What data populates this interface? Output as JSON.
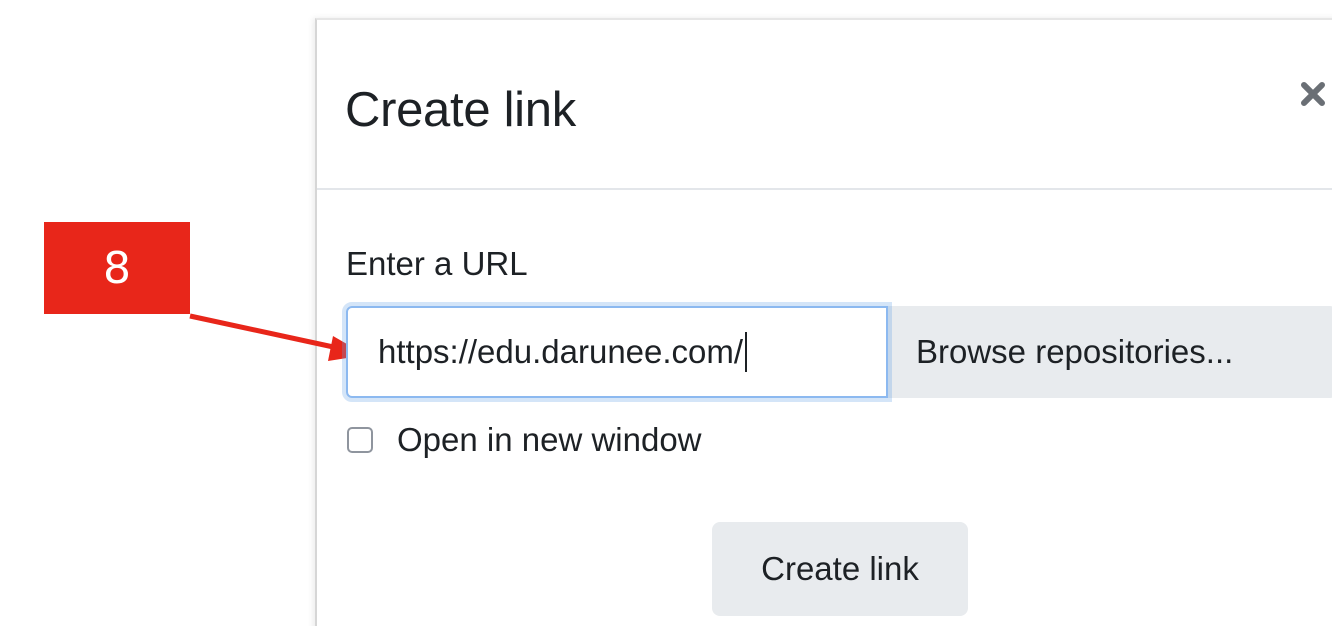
{
  "modal": {
    "title": "Create link",
    "close_icon": "close-icon"
  },
  "form": {
    "url_label": "Enter a URL",
    "url_value": "https://edu.darunee.com/",
    "browse_label": "Browse repositories...",
    "new_window_label": "Open in new window",
    "new_window_checked": false,
    "submit_label": "Create link"
  },
  "annotation": {
    "step_number": "8",
    "color": "#e8261a"
  },
  "colors": {
    "focus_border": "#8cb9f0",
    "button_bg": "#e8ebee",
    "text": "#1d2125"
  }
}
